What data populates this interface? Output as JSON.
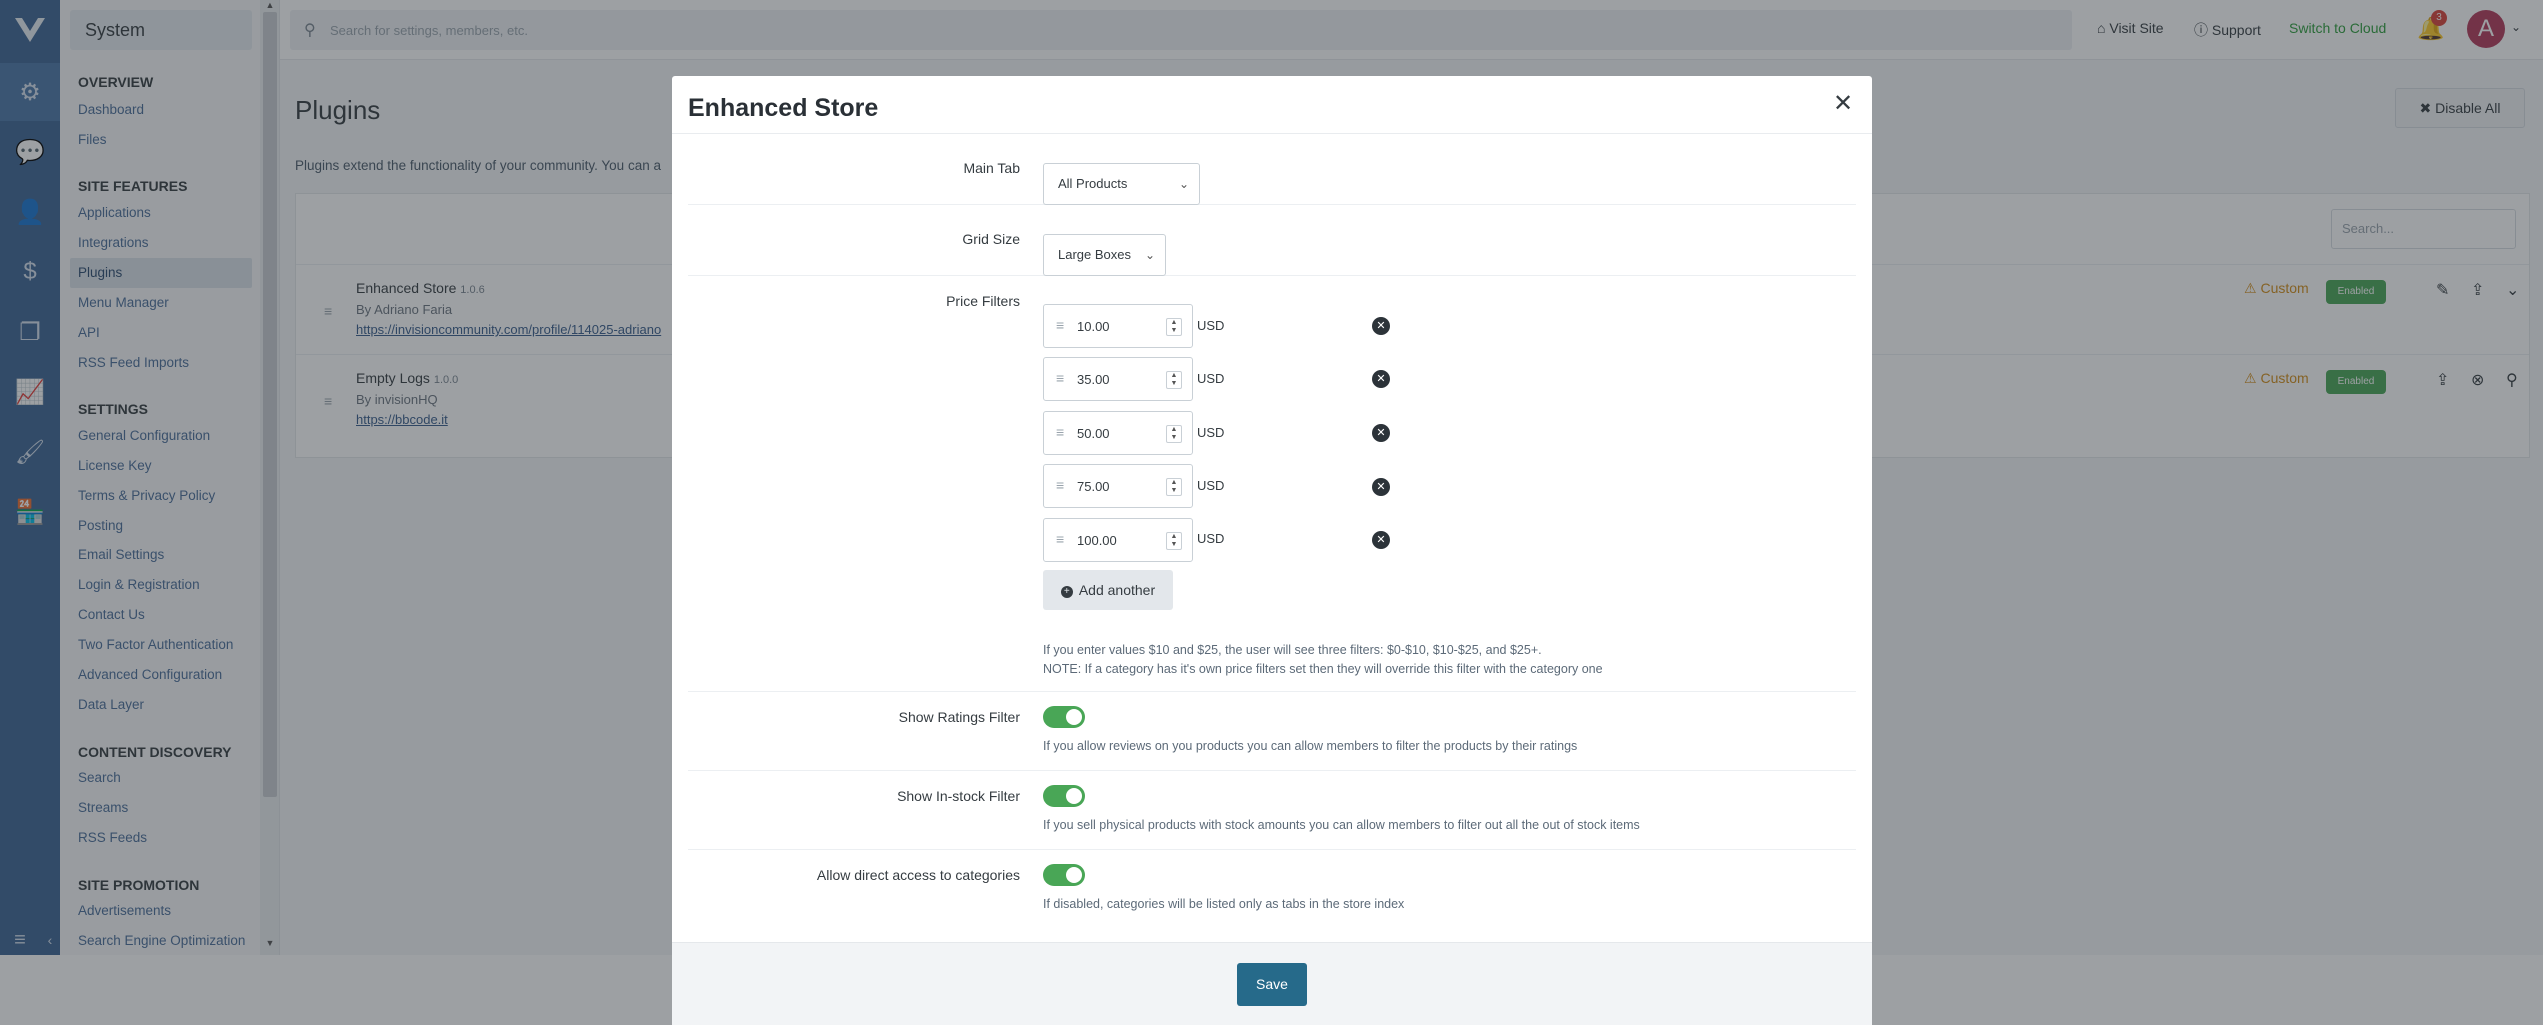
{
  "nav": {
    "system_label": "System",
    "sections": [
      {
        "title": "OVERVIEW",
        "items": [
          "Dashboard",
          "Files"
        ]
      },
      {
        "title": "SITE FEATURES",
        "items": [
          "Applications",
          "Integrations",
          "Plugins",
          "Menu Manager",
          "API",
          "RSS Feed Imports"
        ]
      },
      {
        "title": "SETTINGS",
        "items": [
          "General Configuration",
          "License Key",
          "Terms & Privacy Policy",
          "Posting",
          "Email Settings",
          "Login & Registration",
          "Contact Us",
          "Two Factor Authentication",
          "Advanced Configuration",
          "Data Layer"
        ]
      },
      {
        "title": "CONTENT DISCOVERY",
        "items": [
          "Search",
          "Streams",
          "RSS Feeds"
        ]
      },
      {
        "title": "SITE PROMOTION",
        "items": [
          "Advertisements",
          "Search Engine Optimization"
        ]
      }
    ],
    "active_item": "Plugins"
  },
  "header": {
    "search_placeholder": "Search for settings, members, etc.",
    "visit_site": "Visit Site",
    "support": "Support",
    "switch_cloud": "Switch to Cloud",
    "notification_count": "3",
    "avatar_letter": "A"
  },
  "page": {
    "title": "Plugins",
    "disable_all": "Disable All",
    "description": "Plugins extend the functionality of your community. You can a",
    "list_search_placeholder": "Search...",
    "plugins": [
      {
        "name": "Enhanced Store",
        "version": "1.0.6",
        "author": "By Adriano Faria",
        "url": "https://invisioncommunity.com/profile/114025-adriano",
        "custom": "Custom",
        "status": "Enabled"
      },
      {
        "name": "Empty Logs",
        "version": "1.0.0",
        "author": "By invisionHQ",
        "url": "https://bbcode.it",
        "custom": "Custom",
        "status": "Enabled"
      }
    ]
  },
  "modal": {
    "title": "Enhanced Store",
    "main_tab": {
      "label": "Main Tab",
      "value": "All Products"
    },
    "grid_size": {
      "label": "Grid Size",
      "value": "Large Boxes"
    },
    "price_filters": {
      "label": "Price Filters",
      "currency": "USD",
      "values": [
        "10.00",
        "35.00",
        "50.00",
        "75.00",
        "100.00"
      ],
      "add_another": "Add another",
      "help_1": "If you enter values $10 and $25, the user will see three filters: $0-$10, $10-$25, and $25+.",
      "help_2": "NOTE: If a category has it's own price filters set then they will override this filter with the category one"
    },
    "ratings_filter": {
      "label": "Show Ratings Filter",
      "enabled": true,
      "help": "If you allow reviews on you products you can allow members to filter the products by their ratings"
    },
    "instock_filter": {
      "label": "Show In-stock Filter",
      "enabled": true,
      "help": "If you sell physical products with stock amounts you can allow members to filter out all the out of stock items"
    },
    "direct_access": {
      "label": "Allow direct access to categories",
      "enabled": true,
      "help": "If disabled, categories will be listed only as tabs in the store index"
    },
    "save_label": "Save"
  },
  "colors": {
    "rail": "#3d6594",
    "toggle_on": "#49a656",
    "save": "#266a8a",
    "custom": "#d48f1a"
  }
}
